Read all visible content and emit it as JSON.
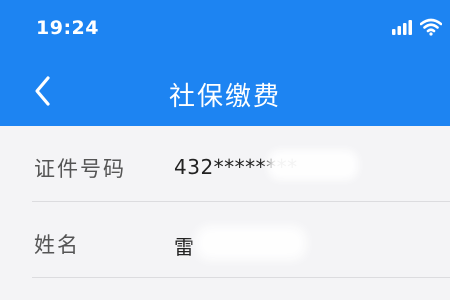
{
  "status_bar": {
    "time": "19:24",
    "icons": [
      "signal-icon",
      "wifi-icon"
    ]
  },
  "navbar": {
    "back_icon": "chevron-left-icon",
    "title": "社保缴费"
  },
  "form": {
    "rows": [
      {
        "label": "证件号码",
        "value": "432********"
      },
      {
        "label": "姓名",
        "value": "雷"
      }
    ]
  },
  "colors": {
    "header_bg": "#1d84f2",
    "content_bg": "#f4f4f6",
    "label_text": "#555555",
    "value_text": "#222222"
  }
}
